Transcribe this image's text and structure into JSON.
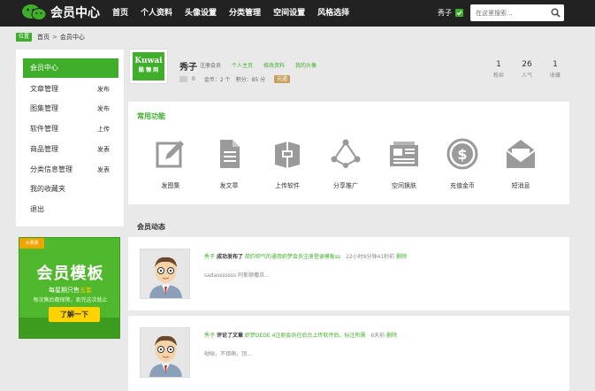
{
  "header": {
    "logo_text": "会员中心",
    "nav": [
      "首页",
      "个人资料",
      "头像设置",
      "分类管理",
      "空间设置",
      "风格选择"
    ],
    "user_name": "秀子",
    "search_placeholder": "在这里搜索..."
  },
  "breadcrumb": {
    "tag": "位置",
    "items": [
      "首页",
      "会员中心"
    ],
    "separator": ">"
  },
  "sidebar": {
    "items": [
      {
        "label": "会员中心",
        "tag": ""
      },
      {
        "label": "文章管理",
        "tag": "发布"
      },
      {
        "label": "图集管理",
        "tag": "发布"
      },
      {
        "label": "软件管理",
        "tag": "上传"
      },
      {
        "label": "商品管理",
        "tag": "发表"
      },
      {
        "label": "分类信息管理",
        "tag": "发表"
      },
      {
        "label": "我的收藏夹",
        "tag": ""
      },
      {
        "label": "退出",
        "tag": ""
      }
    ]
  },
  "ad": {
    "corner": "大惠惠",
    "title": "会员模板",
    "subtitle_pre": "每星期只售",
    "subtitle_highlight": "五套",
    "subtitle2": "每次售后都保障，卖完这次就止",
    "button": "了解一下"
  },
  "profile": {
    "avatar_text": "Kuwai",
    "avatar_sub": "酷 懒 网",
    "name": "秀子",
    "role": "注册会员",
    "links": [
      "个人主页",
      "修改资料",
      "我的头像"
    ],
    "messages": "0",
    "coins": "金币：2 个",
    "points": "积分：85 分",
    "level": "元道",
    "stats": [
      {
        "num": "1",
        "label": "粉丝"
      },
      {
        "num": "26",
        "label": "人气"
      },
      {
        "num": "1",
        "label": "收藏"
      }
    ]
  },
  "functions": {
    "title": "常用功能",
    "items": [
      "发图集",
      "发文章",
      "上传软件",
      "分享推广",
      "空间换肤",
      "充值金币",
      "短消息"
    ]
  },
  "activity": {
    "title": "会员动态",
    "items": [
      {
        "user": "秀子",
        "action": "成功发布了",
        "target": "简约帅气的通用织梦会员注册登录模板ss",
        "time": "22小时9分钟41秒前",
        "delete": "删除",
        "summary": "sadasssssss 阿斯顿撒旦..."
      },
      {
        "user": "秀子",
        "action": "评论了文章",
        "target": "织梦DEDE 4注册会员在后台上传软件后，标注所需",
        "time": "6天前",
        "delete": "删除",
        "summary": "呦呦，不错啊，顶..."
      }
    ]
  },
  "colors": {
    "accent": "#3fae2a",
    "topbar": "#222222",
    "background": "#e9e9e9"
  }
}
